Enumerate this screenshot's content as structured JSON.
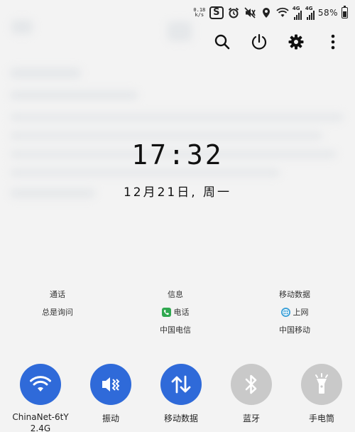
{
  "colors": {
    "accent": "#2f6ad9",
    "tile_inactive": "#c9c9c9",
    "phone_green": "#2fa84f",
    "browser_teal": "#3aa0d8"
  },
  "status_bar": {
    "net_speed_value": "0.18",
    "net_speed_unit": "k/s",
    "icons": [
      "sogou-input-icon",
      "alarm-icon",
      "mute-icon",
      "location-icon",
      "wifi-icon",
      "signal-icon",
      "signal-icon"
    ],
    "sim1_tag": "4G",
    "sim2_tag": "4G",
    "battery_percent": "58%",
    "battery_level": 0.58
  },
  "action_bar": {
    "icons": [
      "search-icon",
      "power-icon",
      "gear-icon",
      "more-vert-icon"
    ]
  },
  "clock": {
    "time": "17:32",
    "date": "12月21日, 周一"
  },
  "sim_info": {
    "col1": {
      "title": "通话",
      "line1": "总是询问"
    },
    "col2": {
      "title": "信息",
      "line1": "电话",
      "line2": "中国电信"
    },
    "col3": {
      "title": "移动数据",
      "line1": "上网",
      "line2": "中国移动"
    }
  },
  "tiles": {
    "wifi": {
      "label": "ChinaNet-6tY",
      "sub": "2.4G",
      "active": true
    },
    "vibrate": {
      "label": "振动",
      "active": true
    },
    "mobile_data": {
      "label": "移动数据",
      "active": true
    },
    "bluetooth": {
      "label": "蓝牙",
      "active": false
    },
    "flashlight": {
      "label": "手电筒",
      "active": false
    }
  }
}
